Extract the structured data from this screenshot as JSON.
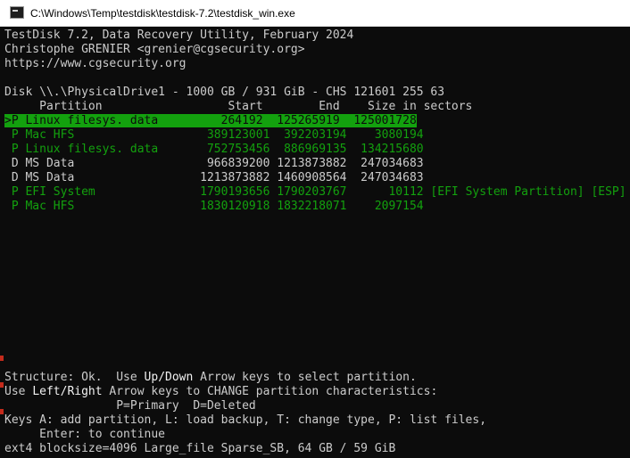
{
  "window": {
    "title": "C:\\Windows\\Temp\\testdisk\\testdisk-7.2\\testdisk_win.exe",
    "icon": "console-app-icon"
  },
  "console": {
    "header": [
      "TestDisk 7.2, Data Recovery Utility, February 2024",
      "Christophe GRENIER <grenier@cgsecurity.org>",
      "https://www.cgsecurity.org"
    ],
    "disk_line": "Disk \\\\.\\PhysicalDrive1 - 1000 GB / 931 GiB - CHS 121601 255 63",
    "columns_line": "     Partition                  Start        End    Size in sectors",
    "partitions": [
      {
        "text": ">P Linux filesys. data         264192  125265919  125001728",
        "extra": "",
        "style": "selected"
      },
      {
        "text": " P Mac HFS                   389123001  392203194    3080194",
        "extra": "",
        "style": "green"
      },
      {
        "text": " P Linux filesys. data       752753456  886969135  134215680",
        "extra": "",
        "style": "green"
      },
      {
        "text": " D MS Data                   966839200 1213873882  247034683",
        "extra": "",
        "style": "deleted"
      },
      {
        "text": " D MS Data                  1213873882 1460908564  247034683",
        "extra": "",
        "style": "deleted"
      },
      {
        "text": " P EFI System               1790193656 1790203767      10112",
        "extra": " [EFI System Partition] [ESP]",
        "style": "green"
      },
      {
        "text": " P Mac HFS                  1830120918 1832218071    2097154",
        "extra": "",
        "style": "green"
      }
    ],
    "footer": {
      "structure_a": "Structure: Ok.  Use ",
      "structure_b": "Up/Down",
      "structure_c": " Arrow keys to select partition.",
      "use_a": "Use ",
      "use_b": "Left/Right",
      "use_c": " Arrow keys to CHANGE partition characteristics:",
      "legend": "                P=Primary  D=Deleted",
      "keys": "Keys A: add partition, L: load backup, T: change type, P: list files,",
      "enter": "     Enter: to continue",
      "fsinfo": "ext4 blocksize=4096 Large_file Sparse_SB, 64 GB / 59 GiB"
    }
  },
  "colors": {
    "console_bg": "#0c0c0c",
    "text": "#cccccc",
    "green": "#13a10e",
    "highlight_bg": "#13a10e"
  }
}
